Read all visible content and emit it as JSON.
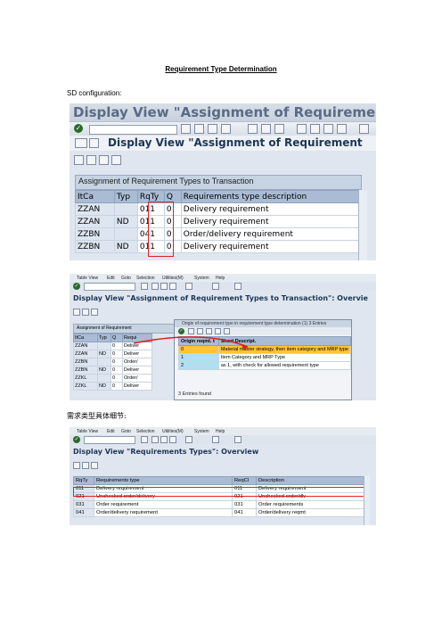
{
  "doc": {
    "title": "Requirement Type Determination",
    "sd_label": "SD configuration:",
    "zh_label": "需求类型具体细节:"
  },
  "shot1": {
    "window_title": "Display View \"Assignment of Requirement Types",
    "app_title": "Display View \"Assignment of Requirement",
    "panel_title": "Assignment of Requirement Types to Transaction",
    "columns": [
      "ItCa",
      "Typ",
      "RqTy",
      "Q",
      "Requirements type description"
    ],
    "rows": [
      [
        "ZZAN",
        "",
        "011",
        "0",
        "Delivery requirement"
      ],
      [
        "ZZAN",
        "ND",
        "011",
        "0",
        "Delivery requirement"
      ],
      [
        "ZZBN",
        "",
        "041",
        "0",
        "Order/delivery requirement"
      ],
      [
        "ZZBN",
        "ND",
        "011",
        "0",
        "Delivery requirement"
      ]
    ]
  },
  "shot2": {
    "menu": [
      "Table View",
      "Edit",
      "Goto",
      "Selection",
      "Utilities(M)",
      "System",
      "Help"
    ],
    "app_title": "Display View \"Assignment of Requirement Types to Transaction\": Overvie",
    "panel_title": "Assignment of Requirement",
    "columns": [
      "ItCa",
      "Typ",
      "Q",
      "Requi"
    ],
    "rows": [
      [
        "ZZAN",
        "",
        "0",
        "Deliver"
      ],
      [
        "ZZAN",
        "ND",
        "0",
        "Deliver"
      ],
      [
        "ZZBN",
        "",
        "0",
        "Order/"
      ],
      [
        "ZZBN",
        "ND",
        "0",
        "Deliver"
      ],
      [
        "ZZKL",
        "",
        "0",
        "Order/"
      ],
      [
        "ZZKL",
        "ND",
        "0",
        "Deliver"
      ]
    ],
    "popup": {
      "title": "Origin of requirement type in requirement type determination (1)   3 Entries",
      "columns": [
        "Origin reqmt. t",
        "Short Descript."
      ],
      "rows": [
        [
          "0",
          "Material master strategy, then item category and MRP type"
        ],
        [
          "1",
          "Item Category and MRP Type"
        ],
        [
          "2",
          "as 1, with check for allowed requirement type"
        ]
      ],
      "entries_found": "3 Entries found"
    }
  },
  "shot3": {
    "menu": [
      "Table View",
      "Edit",
      "Goto",
      "Selection",
      "Utilities(M)",
      "System",
      "Help"
    ],
    "app_title": "Display View \"Requirements Types\": Overview",
    "columns": [
      "RqTy",
      "Requirements type",
      "ReqCl",
      "Description"
    ],
    "rows": [
      [
        "011",
        "Delivery requirement",
        "011",
        "Delivery requirement"
      ],
      [
        "021",
        "Unchecked order/delivery",
        "021",
        "Unchecked order/dlv"
      ],
      [
        "031",
        "Order requirement",
        "031",
        "Order requirements"
      ],
      [
        "041",
        "Order/delivery requirement",
        "041",
        "Order/delivery reqmt"
      ]
    ]
  },
  "colors": {
    "highlight_box": "#dd2222",
    "popup_selected_row": "#ffc533",
    "sap_blue_header": "#a9bcd4"
  }
}
